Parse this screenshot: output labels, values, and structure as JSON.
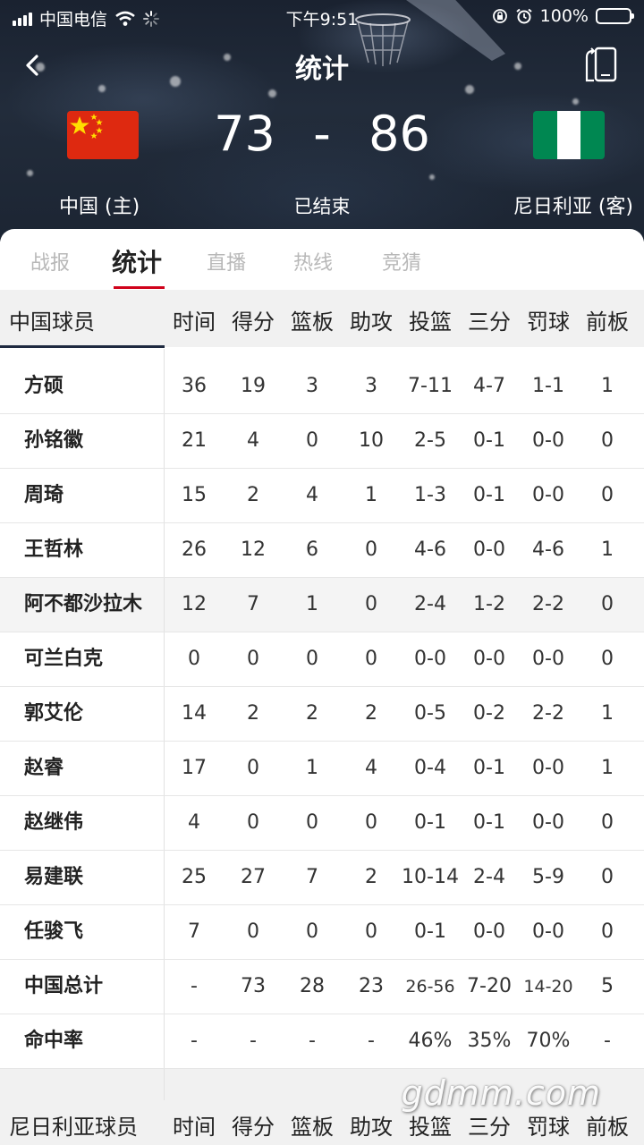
{
  "status_bar": {
    "carrier": "中国电信",
    "time": "下午9:51",
    "battery": "100%",
    "icons": [
      "signal-icon",
      "wifi-icon",
      "loading-icon",
      "orientation-lock-icon",
      "alarm-icon",
      "battery-icon"
    ]
  },
  "nav": {
    "title": "统计",
    "back_icon": "chevron-left-icon",
    "rotate_icon": "rotate-screen-icon"
  },
  "match": {
    "home_score": "73",
    "separator": "-",
    "away_score": "86",
    "home_team": "中国 (主)",
    "away_team": "尼日利亚 (客)",
    "status": "已结束",
    "home_flag_colors": {
      "red": "#de2910",
      "star": "#ffde00"
    },
    "away_flag_colors": {
      "green": "#008751",
      "white": "#ffffff"
    }
  },
  "tabs": [
    {
      "label": "战报",
      "active": false
    },
    {
      "label": "统计",
      "active": true
    },
    {
      "label": "直播",
      "active": false
    },
    {
      "label": "热线",
      "active": false
    },
    {
      "label": "竞猜",
      "active": false
    }
  ],
  "table": {
    "player_header": "中国球员",
    "columns": [
      "时间",
      "得分",
      "篮板",
      "助攻",
      "投篮",
      "三分",
      "罚球",
      "前板"
    ],
    "rows": [
      {
        "name": "方硕",
        "stats": [
          "36",
          "19",
          "3",
          "3",
          "7-11",
          "4-7",
          "1-1",
          "1"
        ]
      },
      {
        "name": "孙铭徽",
        "stats": [
          "21",
          "4",
          "0",
          "10",
          "2-5",
          "0-1",
          "0-0",
          "0"
        ]
      },
      {
        "name": "周琦",
        "stats": [
          "15",
          "2",
          "4",
          "1",
          "1-3",
          "0-1",
          "0-0",
          "0"
        ]
      },
      {
        "name": "王哲林",
        "stats": [
          "26",
          "12",
          "6",
          "0",
          "4-6",
          "0-0",
          "4-6",
          "1"
        ]
      },
      {
        "name": "阿不都沙拉木",
        "stats": [
          "12",
          "7",
          "1",
          "0",
          "2-4",
          "1-2",
          "2-2",
          "0"
        ]
      },
      {
        "name": "可兰白克",
        "stats": [
          "0",
          "0",
          "0",
          "0",
          "0-0",
          "0-0",
          "0-0",
          "0"
        ]
      },
      {
        "name": "郭艾伦",
        "stats": [
          "14",
          "2",
          "2",
          "2",
          "0-5",
          "0-2",
          "2-2",
          "1"
        ]
      },
      {
        "name": "赵睿",
        "stats": [
          "17",
          "0",
          "1",
          "4",
          "0-4",
          "0-1",
          "0-0",
          "1"
        ]
      },
      {
        "name": "赵继伟",
        "stats": [
          "4",
          "0",
          "0",
          "0",
          "0-1",
          "0-1",
          "0-0",
          "0"
        ]
      },
      {
        "name": "易建联",
        "stats": [
          "25",
          "27",
          "7",
          "2",
          "10-14",
          "2-4",
          "5-9",
          "0"
        ]
      },
      {
        "name": "任骏飞",
        "stats": [
          "7",
          "0",
          "0",
          "0",
          "0-1",
          "0-0",
          "0-0",
          "0"
        ]
      }
    ],
    "total": {
      "name": "中国总计",
      "stats": [
        "-",
        "73",
        "28",
        "23",
        "26-56",
        "7-20",
        "14-20",
        "5"
      ]
    },
    "pct": {
      "name": "命中率",
      "stats": [
        "-",
        "-",
        "-",
        "-",
        "46%",
        "35%",
        "70%",
        "-"
      ]
    }
  },
  "table2": {
    "player_header": "尼日利亚球员",
    "columns": [
      "时间",
      "得分",
      "篮板",
      "助攻",
      "投篮",
      "三分",
      "罚球",
      "前板"
    ]
  },
  "watermark": "gdmm.com"
}
